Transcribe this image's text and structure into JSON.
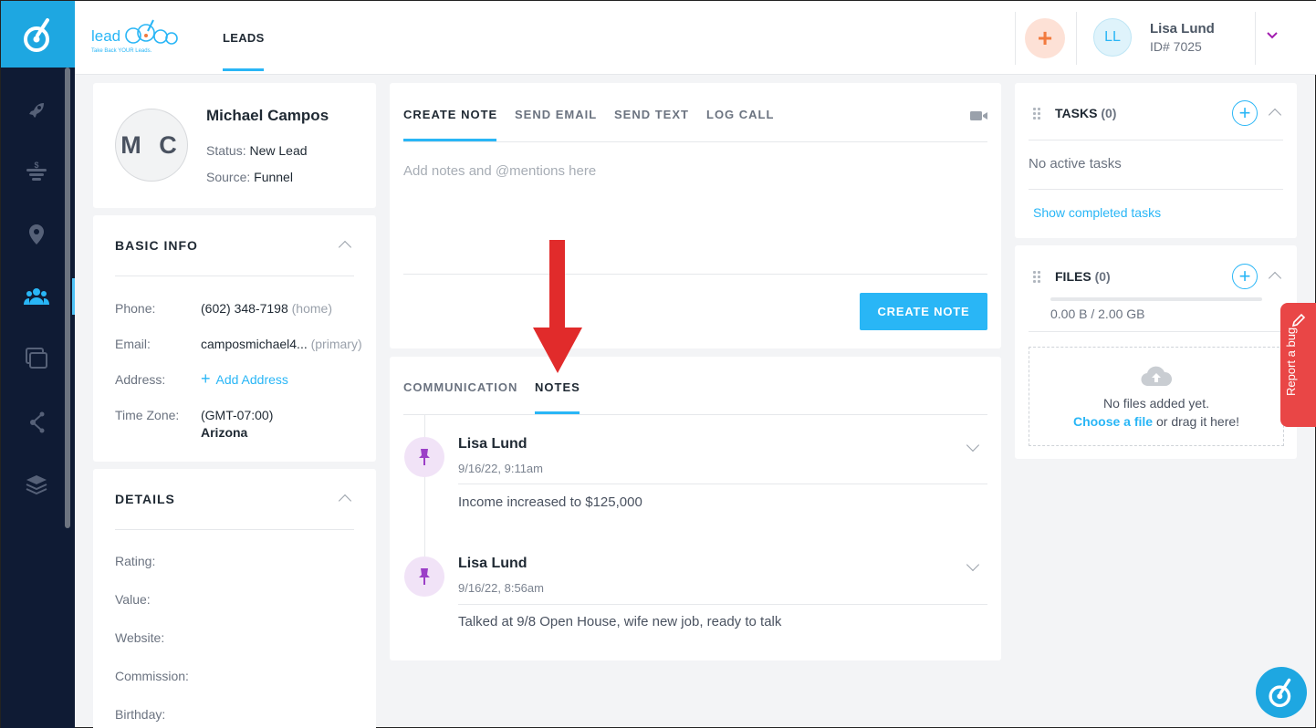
{
  "topbar": {
    "brand_word": "lead",
    "brand_tagline": "Take Back YOUR Leads.",
    "nav_tab": "LEADS",
    "add_symbol": "+",
    "user_initials": "LL",
    "user_name": "Lisa Lund",
    "user_id": "ID# 7025"
  },
  "profile": {
    "initials": "M C",
    "name": "Michael Campos",
    "status_label": "Status:",
    "status_value": "New Lead",
    "source_label": "Source:",
    "source_value": "Funnel"
  },
  "basic_info": {
    "title": "BASIC INFO",
    "phone_label": "Phone:",
    "phone_value": "(602) 348-7198",
    "phone_type": "(home)",
    "email_label": "Email:",
    "email_value": "camposmichael4...",
    "email_type": "(primary)",
    "address_label": "Address:",
    "address_action": "Add Address",
    "timezone_label": "Time Zone:",
    "timezone_offset": "(GMT-07:00)",
    "timezone_name": "Arizona"
  },
  "details": {
    "title": "DETAILS",
    "fields": [
      "Rating:",
      "Value:",
      "Website:",
      "Commission:",
      "Birthday:"
    ]
  },
  "composer": {
    "tabs": [
      "CREATE NOTE",
      "SEND EMAIL",
      "SEND TEXT",
      "LOG CALL"
    ],
    "placeholder": "Add notes and @mentions here",
    "submit_label": "CREATE NOTE"
  },
  "feed": {
    "tabs": [
      "COMMUNICATION",
      "NOTES"
    ],
    "notes": [
      {
        "author": "Lisa Lund",
        "date": "9/16/22, 9:11am",
        "body": "Income increased to $125,000"
      },
      {
        "author": "Lisa Lund",
        "date": "9/16/22, 8:56am",
        "body": "Talked at 9/8 Open House, wife new job, ready to talk"
      }
    ]
  },
  "tasks": {
    "title": "TASKS",
    "count": "(0)",
    "empty": "No active tasks",
    "show_completed": "Show completed tasks"
  },
  "files": {
    "title": "FILES",
    "count": "(0)",
    "storage": "0.00 B / 2.00 GB",
    "empty": "No files added yet.",
    "choose": "Choose a file",
    "drag": " or drag it here!"
  },
  "report_bug": "Report a bug",
  "colors": {
    "accent": "#29b6f6",
    "sidebar": "#0f1b34",
    "brand_blue": "#1ea7e1",
    "annotation_arrow": "#e12b2b",
    "note_pin": "#9b3fc7"
  }
}
